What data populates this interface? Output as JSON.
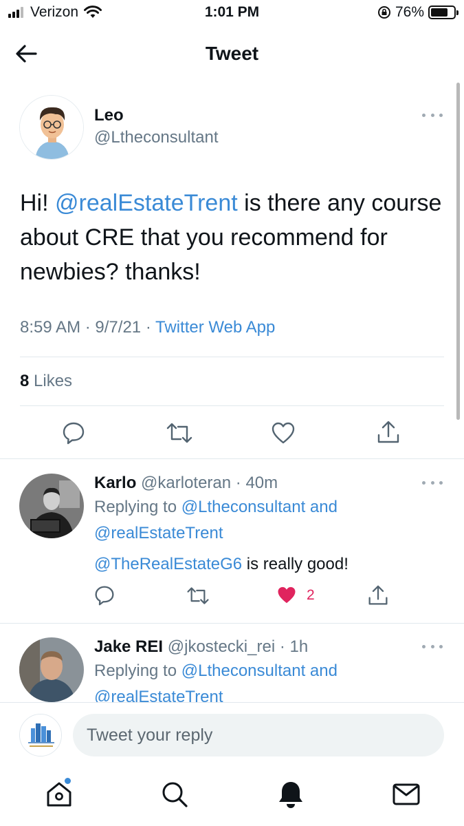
{
  "status_bar": {
    "carrier": "Verizon",
    "time": "1:01 PM",
    "battery": "76%",
    "battery_level": 0.76
  },
  "header": {
    "title": "Tweet",
    "back_icon": "arrow-left-icon"
  },
  "tweet": {
    "author_name": "Leo",
    "author_handle": "@Ltheconsultant",
    "text_before": "Hi! ",
    "mention": "@realEstateTrent",
    "text_after": " is there any course about CRE that you recommend for newbies? thanks!",
    "time": "8:59 AM",
    "date": "9/7/21",
    "source": "Twitter Web App",
    "likes_count": "8",
    "likes_label": "Likes"
  },
  "replies": [
    {
      "name": "Karlo",
      "handle": "@karloteran",
      "age": "40m",
      "replying_to_label": "Replying to",
      "replying_to_1": "@Ltheconsultant",
      "replying_joiner": "and",
      "replying_to_2": "@realEstateTrent",
      "mention": "@TheRealEstateG6",
      "text": " is really good!",
      "like_count": "2"
    },
    {
      "name": "Jake REI",
      "handle": "@jkostecki_rei",
      "age": "1h",
      "replying_to_label": "Replying to",
      "replying_to_1": "@Ltheconsultant",
      "replying_joiner": "and",
      "replying_to_2": "@realEstateTrent"
    }
  ],
  "composer": {
    "placeholder": "Tweet your reply"
  },
  "tab_bar": {
    "items": [
      "home-icon",
      "search-icon",
      "notifications-bell-icon",
      "messages-envelope-icon"
    ]
  },
  "colors": {
    "link": "#3a8ad6",
    "secondary": "#657786",
    "like_active": "#e0245e"
  }
}
